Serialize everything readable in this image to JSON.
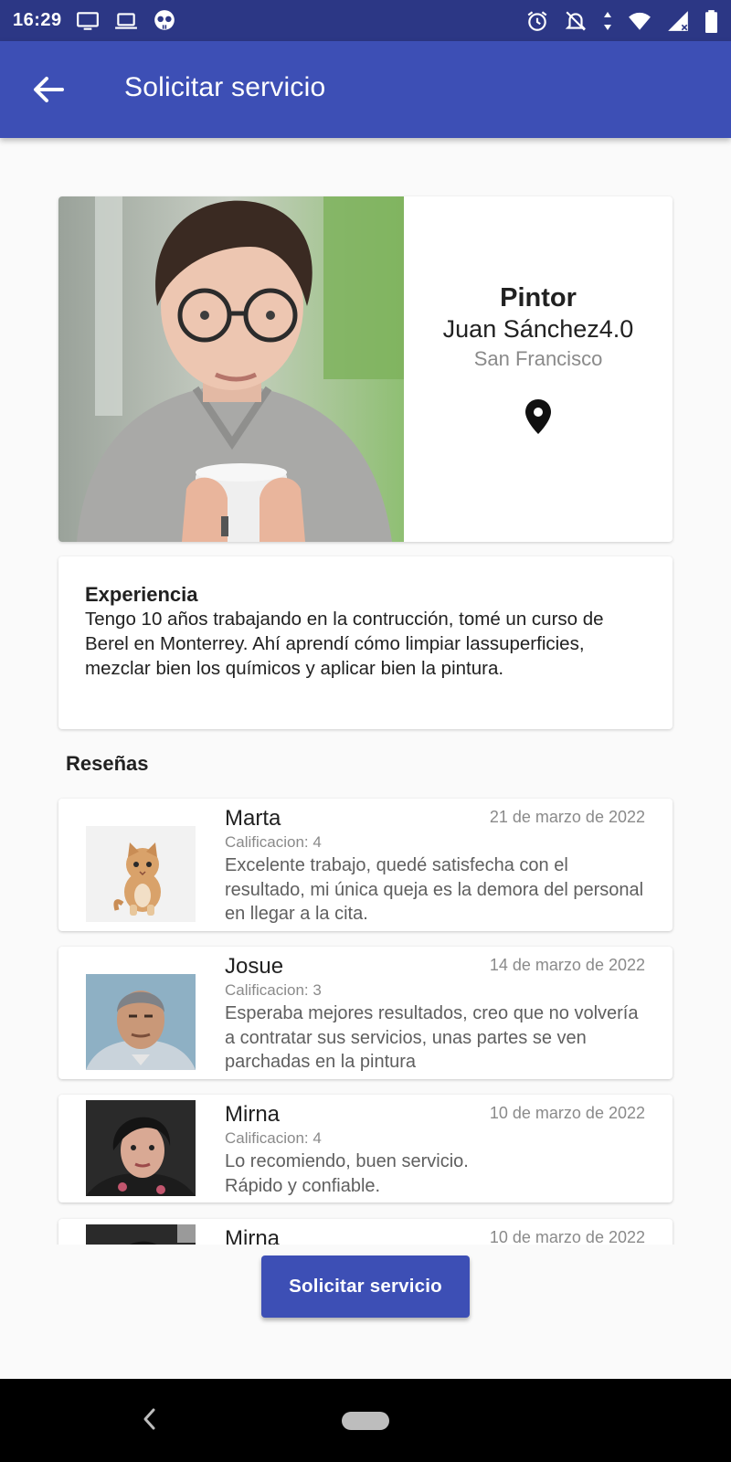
{
  "status_bar": {
    "time": "16:29",
    "left_icons": [
      "monitor-icon",
      "laptop-icon",
      "skull-icon"
    ],
    "right_icons": [
      "alarm-icon",
      "notifications-off-icon",
      "data-arrows-icon",
      "wifi-icon",
      "signal-icon",
      "battery-icon"
    ]
  },
  "app_bar": {
    "back_icon": "arrow-back-icon",
    "title": "Solicitar servicio",
    "color": "#3d4fb5"
  },
  "profile": {
    "profession": "Pintor",
    "name": "Juan Sánchez4.0",
    "city": "San Francisco",
    "location_icon": "location-pin-icon"
  },
  "experience": {
    "title": "Experiencia",
    "text": "Tengo 10 años trabajando en la contrucción, tomé un curso de Berel en Monterrey. Ahí aprendí cómo limpiar lassuperficies, mezclar bien los químicos y aplicar bien la pintura."
  },
  "reviews": {
    "heading": "Reseñas",
    "items": [
      {
        "name": "Marta",
        "date": "21 de marzo de 2022",
        "rating": "Calificacion: 4",
        "text": "Excelente trabajo, quedé satisfecha con el resultado, mi única queja es la demora del personal en llegar a la cita."
      },
      {
        "name": "Josue",
        "date": "14 de marzo de 2022",
        "rating": "Calificacion: 3",
        "text": "Esperaba mejores resultados, creo que no volvería a contratar sus servicios, unas partes se ven parchadas en la pintura"
      },
      {
        "name": "Mirna",
        "date": "10 de marzo de 2022",
        "rating": "Calificacion: 4",
        "text": "Lo recomiendo, buen servicio.\n    Rápido y confiable."
      },
      {
        "name": "Mirna",
        "date": "10 de marzo de 2022",
        "rating": "",
        "text": ""
      }
    ]
  },
  "request_button": {
    "label": "Solicitar servicio"
  },
  "nav_bar": {
    "back_icon": "nav-back-icon",
    "home_icon": "nav-home-pill-icon"
  }
}
